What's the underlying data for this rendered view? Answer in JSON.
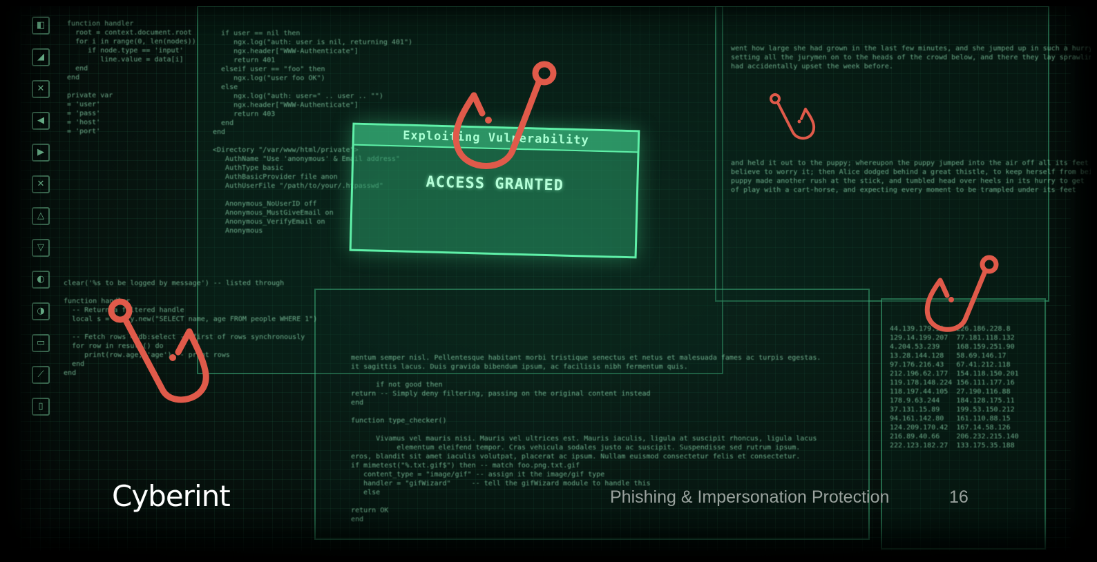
{
  "slide": {
    "logo_text": "Cyberint",
    "footer_title": "Phishing & Impersonation Protection",
    "page_number": "16"
  },
  "screen": {
    "modal_title": "Exploiting Vulnerability",
    "modal_message": "ACCESS GRANTED"
  },
  "colors": {
    "hook": "#e05a4a",
    "screen_green": "#5ff0a8",
    "footer_text": "#9aa29e"
  },
  "icons": [
    "fishing-hook-icon"
  ]
}
